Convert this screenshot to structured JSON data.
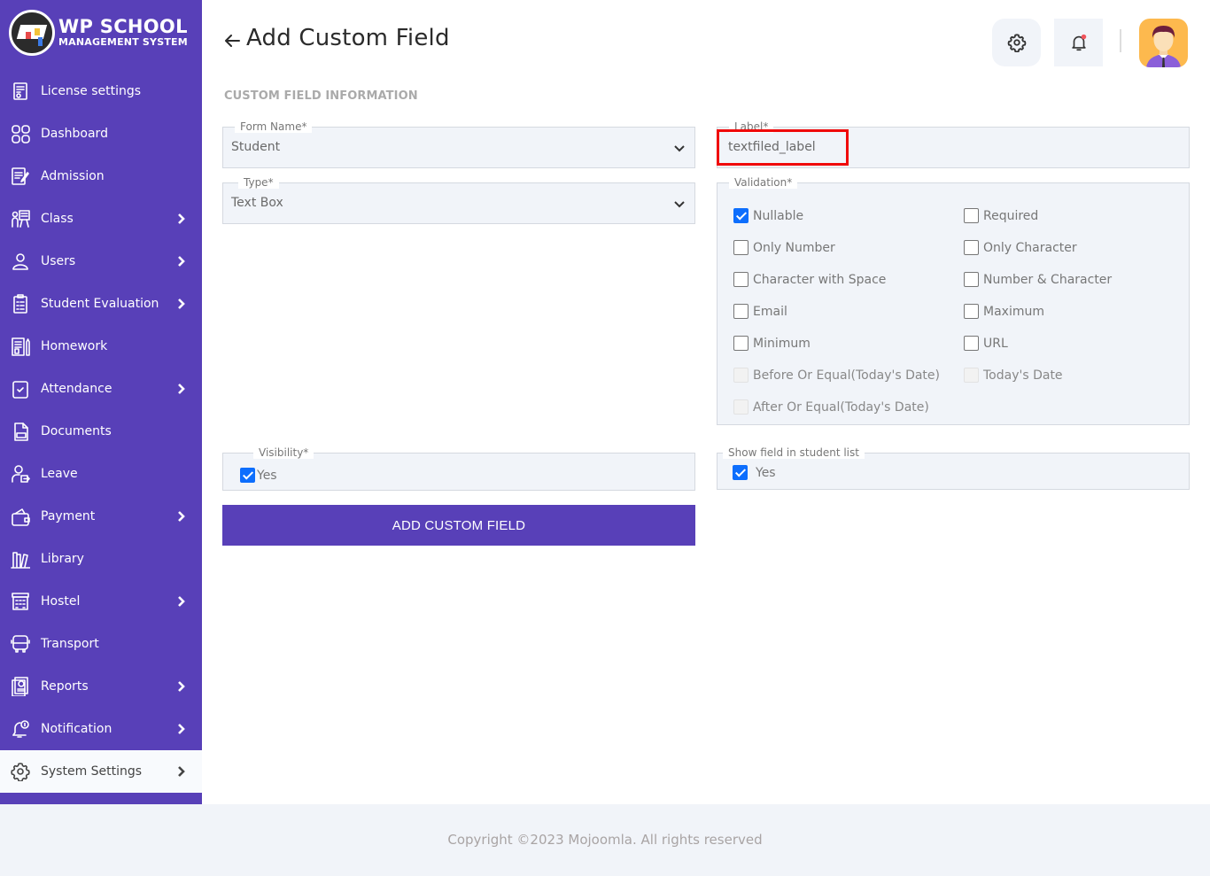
{
  "app": {
    "logo_title": "WP SCHOOL",
    "logo_subtitle": "MANAGEMENT SYSTEM"
  },
  "sidebar": {
    "items": [
      {
        "label": "License settings",
        "icon": "license-icon",
        "has_submenu": false
      },
      {
        "label": "Dashboard",
        "icon": "dashboard-icon",
        "has_submenu": false
      },
      {
        "label": "Admission",
        "icon": "admission-icon",
        "has_submenu": false
      },
      {
        "label": "Class",
        "icon": "class-icon",
        "has_submenu": true
      },
      {
        "label": "Users",
        "icon": "user-icon",
        "has_submenu": true
      },
      {
        "label": "Student Evaluation",
        "icon": "evaluation-icon",
        "has_submenu": true
      },
      {
        "label": "Homework",
        "icon": "homework-icon",
        "has_submenu": false
      },
      {
        "label": "Attendance",
        "icon": "attendance-icon",
        "has_submenu": true
      },
      {
        "label": "Documents",
        "icon": "documents-icon",
        "has_submenu": false
      },
      {
        "label": "Leave",
        "icon": "leave-icon",
        "has_submenu": false
      },
      {
        "label": "Payment",
        "icon": "wallet-icon",
        "has_submenu": true
      },
      {
        "label": "Library",
        "icon": "library-icon",
        "has_submenu": false
      },
      {
        "label": "Hostel",
        "icon": "hostel-icon",
        "has_submenu": true
      },
      {
        "label": "Transport",
        "icon": "bus-icon",
        "has_submenu": false
      },
      {
        "label": "Reports",
        "icon": "reports-icon",
        "has_submenu": true
      },
      {
        "label": "Notification",
        "icon": "notification-icon",
        "has_submenu": true
      },
      {
        "label": "System Settings",
        "icon": "gear-icon",
        "has_submenu": true,
        "active": true
      }
    ]
  },
  "header": {
    "title": "Add Custom Field",
    "back_icon": "arrow-left-icon",
    "settings_icon": "gear-icon",
    "notification_icon": "bell-icon",
    "has_unread_notification": true
  },
  "form": {
    "section_title": "CUSTOM FIELD INFORMATION",
    "form_name": {
      "label": "Form Name*",
      "value": "Student"
    },
    "type": {
      "label": "Type*",
      "value": "Text Box"
    },
    "field_label": {
      "label": "Label*",
      "value": "textfiled_label"
    },
    "validation": {
      "label": "Validation*",
      "options": [
        {
          "label": "Nullable",
          "checked": true,
          "disabled": false
        },
        {
          "label": "Required",
          "checked": false,
          "disabled": false
        },
        {
          "label": "Only Number",
          "checked": false,
          "disabled": false
        },
        {
          "label": "Only Character",
          "checked": false,
          "disabled": false
        },
        {
          "label": "Character with Space",
          "checked": false,
          "disabled": false
        },
        {
          "label": "Number & Character",
          "checked": false,
          "disabled": false
        },
        {
          "label": "Email",
          "checked": false,
          "disabled": false
        },
        {
          "label": "Maximum",
          "checked": false,
          "disabled": false
        },
        {
          "label": "Minimum",
          "checked": false,
          "disabled": false
        },
        {
          "label": "URL",
          "checked": false,
          "disabled": false
        },
        {
          "label": "Before Or Equal(Today's Date)",
          "checked": false,
          "disabled": true
        },
        {
          "label": "Today's Date",
          "checked": false,
          "disabled": true
        },
        {
          "label": "After Or Equal(Today's Date)",
          "checked": false,
          "disabled": true
        }
      ]
    },
    "visibility": {
      "label": "Visibility*",
      "option": "Yes",
      "checked": true
    },
    "show_in_list": {
      "label": "Show field in student list",
      "option": "Yes",
      "checked": true
    },
    "submit_label": "ADD CUSTOM FIELD"
  },
  "footer": {
    "copyright": "Copyright ©2023 Mojoomla. All rights reserved"
  },
  "colors": {
    "brand": "#5840b8",
    "checkbox": "#0d6efd",
    "highlight": "#f00a0a",
    "field_bg": "#f1f4f9"
  }
}
